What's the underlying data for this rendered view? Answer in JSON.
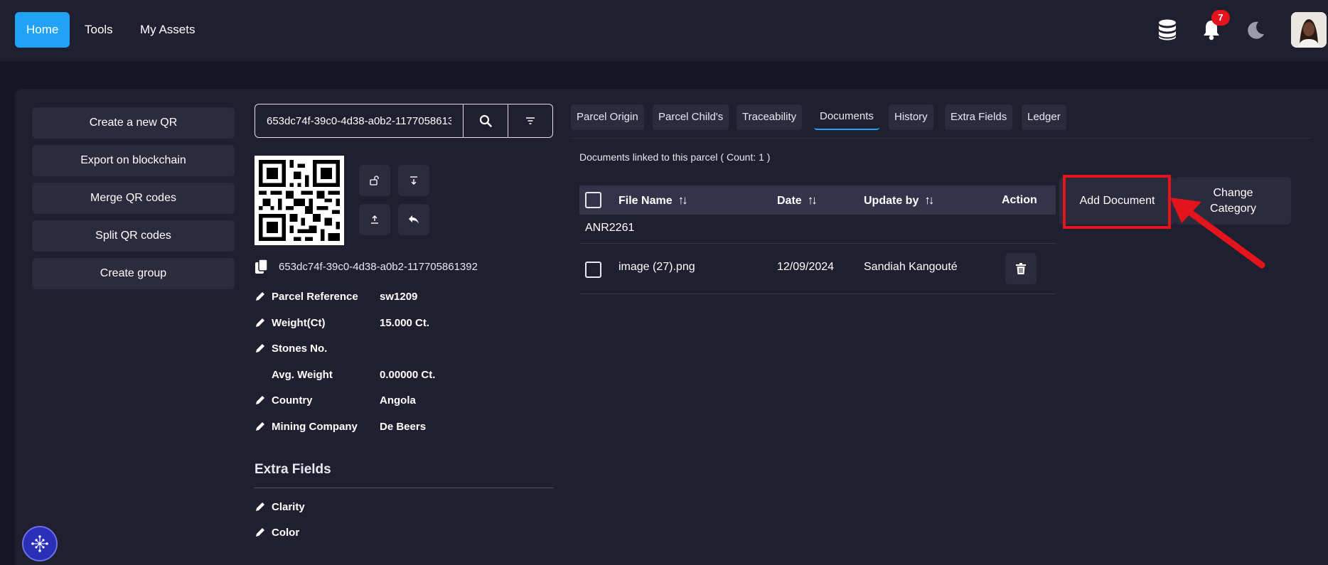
{
  "nav": {
    "home": "Home",
    "tools": "Tools",
    "assets": "My Assets",
    "notification_count": "7",
    "icons": [
      "database-icon",
      "bell-icon",
      "moon-icon"
    ]
  },
  "sidebar": {
    "items": [
      {
        "label": "Create a new QR"
      },
      {
        "label": "Export on blockchain"
      },
      {
        "label": "Merge QR codes"
      },
      {
        "label": "Split QR codes"
      },
      {
        "label": "Create group"
      }
    ]
  },
  "search": {
    "value": "653dc74f-39c0-4d38-a0b2-117705861392"
  },
  "parcel": {
    "uuid": "653dc74f-39c0-4d38-a0b2-117705861392",
    "fields": [
      {
        "label": "Parcel Reference",
        "value": "sw1209",
        "editable": true
      },
      {
        "label": "Weight(Ct)",
        "value": "15.000 Ct.",
        "editable": true
      },
      {
        "label": "Stones No.",
        "value": "",
        "editable": true
      },
      {
        "label": "Avg. Weight",
        "value": "0.00000 Ct.",
        "editable": false
      },
      {
        "label": "Country",
        "value": "Angola",
        "editable": true
      },
      {
        "label": "Mining Company",
        "value": "De Beers",
        "editable": true
      }
    ],
    "extra_title": "Extra Fields",
    "extra_fields": [
      {
        "label": "Clarity"
      },
      {
        "label": "Color"
      }
    ]
  },
  "tabs": [
    {
      "label": "Parcel Origin"
    },
    {
      "label": "Parcel Child's"
    },
    {
      "label": "Traceability"
    },
    {
      "label": "Documents",
      "active": true
    },
    {
      "label": "History"
    },
    {
      "label": "Extra Fields"
    },
    {
      "label": "Ledger"
    }
  ],
  "documents": {
    "count_text": "Documents linked to this parcel ( Count: 1 )",
    "headers": {
      "file": "File Name",
      "date": "Date",
      "user": "Update by",
      "action": "Action"
    },
    "group": "ANR2261",
    "rows": [
      {
        "file": "image (27).png",
        "date": "12/09/2024",
        "user": "Sandiah Kangouté"
      }
    ],
    "add_label": "Add Document",
    "change_label": "Change Category"
  },
  "colors": {
    "accent": "#20a3f5",
    "highlight": "#e3141c",
    "background": "#161625",
    "panel": "#1f1f2f"
  }
}
